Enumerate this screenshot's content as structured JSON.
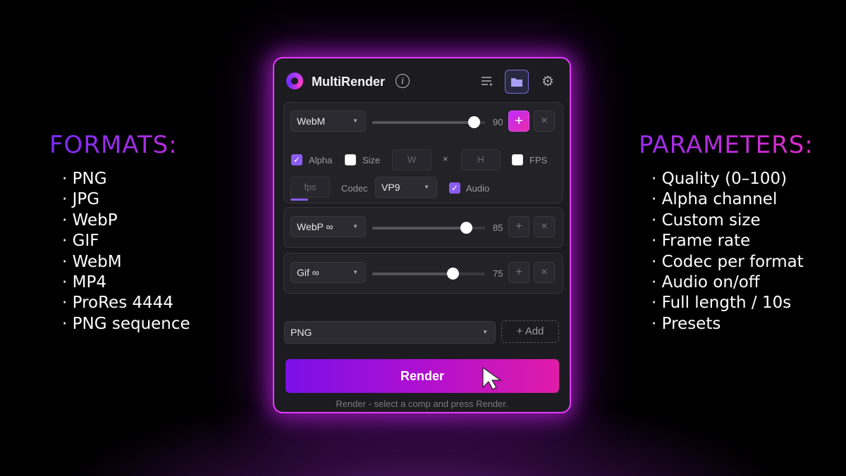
{
  "left_section": {
    "heading": "FORMATS:",
    "items": [
      "PNG",
      "JPG",
      "WebP",
      "GIF",
      "WebM",
      "MP4",
      "ProRes 4444",
      "PNG sequence"
    ]
  },
  "right_section": {
    "heading": "PARAMETERS:",
    "items": [
      "Quality (0–100)",
      "Alpha channel",
      "Custom size",
      "Frame rate",
      "Codec per format",
      "Audio on/off",
      "Full length / 10s",
      "Presets"
    ]
  },
  "app": {
    "title": "MultiRender",
    "info_icon": "i",
    "icons": [
      "aperture-logo",
      "info-icon",
      "list-icon",
      "folder-icon",
      "gear-icon"
    ]
  },
  "outputs": [
    {
      "format": "WebM",
      "quality": 90,
      "quality_max": 100,
      "alpha_label": "Alpha",
      "alpha_checked": true,
      "size_label": "Size",
      "size_checked": false,
      "width_placeholder": "W",
      "times": "×",
      "height_placeholder": "H",
      "fps_label": "FPS",
      "fps_checked": false,
      "fps_placeholder": "fps",
      "codec_label": "Codec",
      "codec_value": "VP9",
      "audio_label": "Audio",
      "audio_checked": true,
      "plus_label": "+",
      "close_label": "×"
    },
    {
      "format": "WebP ∞",
      "quality": 85,
      "plus_label": "+",
      "close_label": "×"
    },
    {
      "format": "Gif ∞",
      "quality": 75,
      "plus_label": "+",
      "close_label": "×"
    }
  ],
  "new_format": {
    "value": "PNG",
    "add_label": "+ Add"
  },
  "render_button": "Render",
  "status_text": "Render - select a comp and press Render.",
  "colors": {
    "accent_start": "#7a10e8",
    "accent_end": "#e01ca8",
    "glow": "#e43cff",
    "check": "#8a5cf0"
  }
}
